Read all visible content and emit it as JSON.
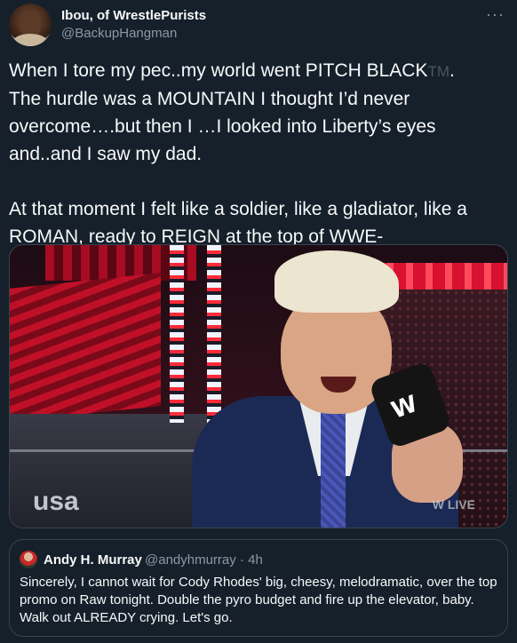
{
  "author": {
    "display_name": "Ibou, of WrestlePurists",
    "handle": "@BackupHangman"
  },
  "more_menu_icon": "more-horizontal-icon",
  "tweet": {
    "line1_pre": "When I tore my pec..my world went PITCH BLACK",
    "tm": "TM",
    "line1_post": ".",
    "rest": "The hurdle was a MOUNTAIN I thought I’d never overcome….but then I …I looked into Liberty’s eyes and..and I saw my dad.\n\nAt that moment I felt like a soldier, like a gladiator, like a ROMAN, ready to REIGN at the top of WWE-"
  },
  "media": {
    "broadcaster_logo": "usa",
    "mic_logo": "W",
    "live_badge": "W LIVE"
  },
  "quoted_tweet": {
    "display_name": "Andy H. Murray",
    "meta": "@andyhmurray · 4h",
    "text": "Sincerely, I cannot wait for Cody Rhodes' big, cheesy, melodramatic, over the top promo on Raw tonight. Double the pyro budget and fire up the elevator, baby. Walk out ALREADY crying. Let's go."
  },
  "colors": {
    "background": "#15202b",
    "text": "#f7f9f9",
    "secondary_text": "#8b98a5",
    "border": "#38444d"
  }
}
